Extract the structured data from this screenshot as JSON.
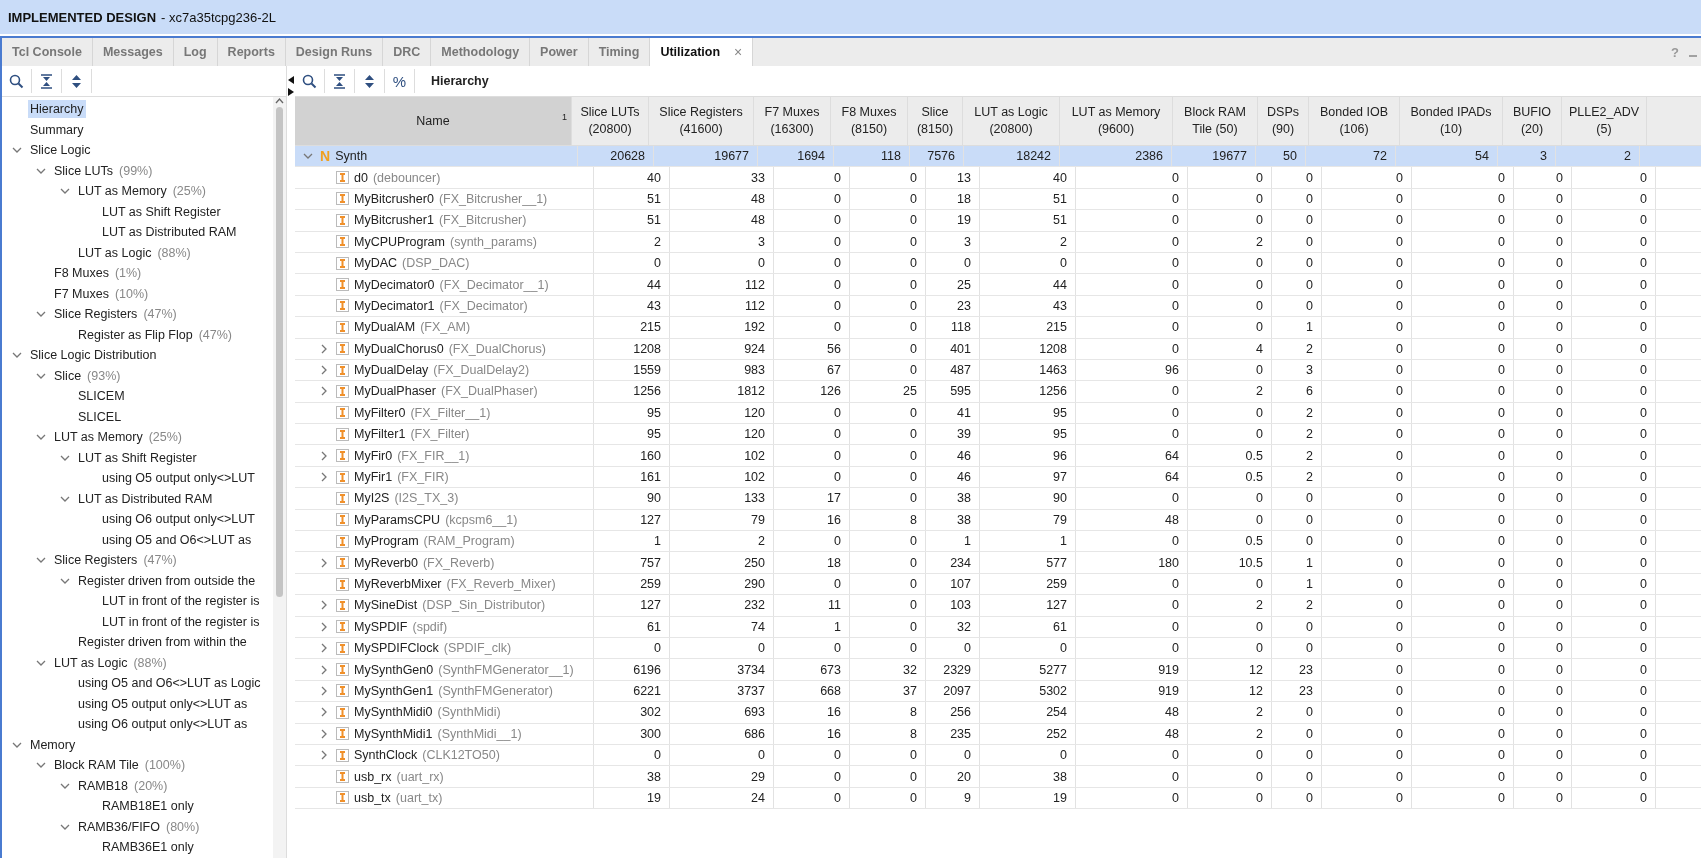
{
  "window": {
    "title": "IMPLEMENTED DESIGN",
    "subtitle": "- xc7a35tcpg236-2L"
  },
  "tabs": [
    {
      "label": "Tcl Console",
      "selected": false
    },
    {
      "label": "Messages",
      "selected": false
    },
    {
      "label": "Log",
      "selected": false
    },
    {
      "label": "Reports",
      "selected": false
    },
    {
      "label": "Design Runs",
      "selected": false
    },
    {
      "label": "DRC",
      "selected": false
    },
    {
      "label": "Methodology",
      "selected": false
    },
    {
      "label": "Power",
      "selected": false
    },
    {
      "label": "Timing",
      "selected": false
    },
    {
      "label": "Utilization",
      "selected": true,
      "close": "×"
    }
  ],
  "help": "?",
  "right_toolbar": {
    "percent": "%",
    "view": "Hierarchy"
  },
  "tree": [
    {
      "label": "Hierarchy",
      "selected": true
    },
    {
      "label": "Summary",
      "selected": false
    },
    {
      "label": "Slice Logic",
      "selected": false,
      "expanded": true,
      "children": [
        {
          "label": "Slice LUTs",
          "percent": "(99%)",
          "selected": false,
          "expanded": true,
          "children": [
            {
              "label": "LUT as Memory",
              "percent": "(25%)",
              "selected": false,
              "expanded": true,
              "children": [
                {
                  "label": "LUT as Shift Register",
                  "selected": false
                },
                {
                  "label": "LUT as Distributed RAM",
                  "selected": false
                }
              ]
            },
            {
              "label": "LUT as Logic",
              "percent": "(88%)",
              "selected": false
            }
          ]
        },
        {
          "label": "F8 Muxes",
          "percent": "(1%)",
          "selected": false
        },
        {
          "label": "F7 Muxes",
          "percent": "(10%)",
          "selected": false
        },
        {
          "label": "Slice Registers",
          "percent": "(47%)",
          "selected": false,
          "expanded": true,
          "children": [
            {
              "label": "Register as Flip Flop",
              "percent": "(47%)",
              "selected": false
            }
          ]
        }
      ]
    },
    {
      "label": "Slice Logic Distribution",
      "selected": false,
      "expanded": true,
      "children": [
        {
          "label": "Slice",
          "percent": "(93%)",
          "selected": false,
          "expanded": true,
          "children": [
            {
              "label": "SLICEM",
              "selected": false
            },
            {
              "label": "SLICEL",
              "selected": false
            }
          ]
        },
        {
          "label": "LUT as Memory",
          "percent": "(25%)",
          "selected": false,
          "expanded": true,
          "children": [
            {
              "label": "LUT as Shift Register",
              "selected": false,
              "expanded": true,
              "children": [
                {
                  "label": "using O5 output only<>LUT",
                  "selected": false
                }
              ]
            },
            {
              "label": "LUT as Distributed RAM",
              "selected": false,
              "expanded": true,
              "children": [
                {
                  "label": "using O6 output only<>LUT",
                  "selected": false
                },
                {
                  "label": "using O5 and O6<>LUT as",
                  "selected": false
                }
              ]
            }
          ]
        },
        {
          "label": "Slice Registers",
          "percent": "(47%)",
          "selected": false,
          "expanded": true,
          "children": [
            {
              "label": "Register driven from outside the",
              "selected": false,
              "expanded": true,
              "children": [
                {
                  "label": "LUT in front of the register is",
                  "selected": false
                },
                {
                  "label": "LUT in front of the register is",
                  "selected": false
                }
              ]
            },
            {
              "label": "Register driven from within the",
              "selected": false
            }
          ]
        },
        {
          "label": "LUT as Logic",
          "percent": "(88%)",
          "selected": false,
          "expanded": true,
          "children": [
            {
              "label": "using O5 and O6<>LUT as Logic",
              "selected": false
            },
            {
              "label": "using O5 output only<>LUT as",
              "selected": false
            },
            {
              "label": "using O6 output only<>LUT as",
              "selected": false
            }
          ]
        }
      ]
    },
    {
      "label": "Memory",
      "selected": false,
      "expanded": true,
      "children": [
        {
          "label": "Block RAM Tile",
          "percent": "(100%)",
          "selected": false,
          "expanded": true,
          "children": [
            {
              "label": "RAMB18",
              "percent": "(20%)",
              "selected": false,
              "expanded": true,
              "children": [
                {
                  "label": "RAMB18E1 only",
                  "selected": false
                }
              ]
            },
            {
              "label": "RAMB36/FIFO",
              "percent": "(80%)",
              "selected": false,
              "expanded": true,
              "children": [
                {
                  "label": "RAMB36E1 only",
                  "selected": false
                }
              ]
            }
          ]
        }
      ]
    }
  ],
  "table": {
    "columns": [
      {
        "label": "Name",
        "sort_rank": "1"
      },
      {
        "label": "Slice LUTs",
        "sub": "(20800)"
      },
      {
        "label": "Slice Registers",
        "sub": "(41600)"
      },
      {
        "label": "F7 Muxes",
        "sub": "(16300)"
      },
      {
        "label": "F8 Muxes",
        "sub": "(8150)"
      },
      {
        "label": "Slice",
        "sub": "(8150)"
      },
      {
        "label": "LUT as Logic",
        "sub": "(20800)"
      },
      {
        "label": "LUT as Memory",
        "sub": "(9600)"
      },
      {
        "label": "Block RAM",
        "sub": "Tile (50)"
      },
      {
        "label": "DSPs",
        "sub": "(90)"
      },
      {
        "label": "Bonded IOB",
        "sub": "(106)"
      },
      {
        "label": "Bonded IPADs",
        "sub": "(10)"
      },
      {
        "label": "BUFIO",
        "sub": "(20)"
      },
      {
        "label": "PLLE2_ADV",
        "sub": "(5)"
      }
    ],
    "rows": [
      {
        "kind": "top",
        "badge": "N",
        "name": "Synth",
        "selected": true,
        "expanded": true,
        "values": [
          "20628",
          "19677",
          "1694",
          "118",
          "7576",
          "18242",
          "2386",
          "19677",
          "50",
          "72",
          "54",
          "3",
          "2"
        ]
      },
      {
        "kind": "instance",
        "name": "d0",
        "module": "(debouncer)",
        "selected": false,
        "expandable": false,
        "values": [
          "40",
          "33",
          "0",
          "0",
          "13",
          "40",
          "0",
          "0",
          "0",
          "0",
          "0",
          "0",
          "0"
        ]
      },
      {
        "kind": "instance",
        "name": "MyBitcrusher0",
        "module": "(FX_Bitcrusher__1)",
        "selected": false,
        "expandable": false,
        "values": [
          "51",
          "48",
          "0",
          "0",
          "18",
          "51",
          "0",
          "0",
          "0",
          "0",
          "0",
          "0",
          "0"
        ]
      },
      {
        "kind": "instance",
        "name": "MyBitcrusher1",
        "module": "(FX_Bitcrusher)",
        "selected": false,
        "expandable": false,
        "values": [
          "51",
          "48",
          "0",
          "0",
          "19",
          "51",
          "0",
          "0",
          "0",
          "0",
          "0",
          "0",
          "0"
        ]
      },
      {
        "kind": "instance",
        "name": "MyCPUProgram",
        "module": "(synth_params)",
        "selected": false,
        "expandable": false,
        "values": [
          "2",
          "3",
          "0",
          "0",
          "3",
          "2",
          "0",
          "2",
          "0",
          "0",
          "0",
          "0",
          "0"
        ]
      },
      {
        "kind": "instance",
        "name": "MyDAC",
        "module": "(DSP_DAC)",
        "selected": false,
        "expandable": false,
        "values": [
          "0",
          "0",
          "0",
          "0",
          "0",
          "0",
          "0",
          "0",
          "0",
          "0",
          "0",
          "0",
          "0"
        ]
      },
      {
        "kind": "instance",
        "name": "MyDecimator0",
        "module": "(FX_Decimator__1)",
        "selected": false,
        "expandable": false,
        "values": [
          "44",
          "112",
          "0",
          "0",
          "25",
          "44",
          "0",
          "0",
          "0",
          "0",
          "0",
          "0",
          "0"
        ]
      },
      {
        "kind": "instance",
        "name": "MyDecimator1",
        "module": "(FX_Decimator)",
        "selected": false,
        "expandable": false,
        "values": [
          "43",
          "112",
          "0",
          "0",
          "23",
          "43",
          "0",
          "0",
          "0",
          "0",
          "0",
          "0",
          "0"
        ]
      },
      {
        "kind": "instance",
        "name": "MyDualAM",
        "module": "(FX_AM)",
        "selected": false,
        "expandable": false,
        "values": [
          "215",
          "192",
          "0",
          "0",
          "118",
          "215",
          "0",
          "0",
          "1",
          "0",
          "0",
          "0",
          "0"
        ]
      },
      {
        "kind": "instance",
        "name": "MyDualChorus0",
        "module": "(FX_DualChorus)",
        "selected": false,
        "expandable": true,
        "values": [
          "1208",
          "924",
          "56",
          "0",
          "401",
          "1208",
          "0",
          "4",
          "2",
          "0",
          "0",
          "0",
          "0"
        ]
      },
      {
        "kind": "instance",
        "name": "MyDualDelay",
        "module": "(FX_DualDelay2)",
        "selected": false,
        "expandable": true,
        "values": [
          "1559",
          "983",
          "67",
          "0",
          "487",
          "1463",
          "96",
          "0",
          "3",
          "0",
          "0",
          "0",
          "0"
        ]
      },
      {
        "kind": "instance",
        "name": "MyDualPhaser",
        "module": "(FX_DualPhaser)",
        "selected": false,
        "expandable": true,
        "values": [
          "1256",
          "1812",
          "126",
          "25",
          "595",
          "1256",
          "0",
          "2",
          "6",
          "0",
          "0",
          "0",
          "0"
        ]
      },
      {
        "kind": "instance",
        "name": "MyFilter0",
        "module": "(FX_Filter__1)",
        "selected": false,
        "expandable": false,
        "values": [
          "95",
          "120",
          "0",
          "0",
          "41",
          "95",
          "0",
          "0",
          "2",
          "0",
          "0",
          "0",
          "0"
        ]
      },
      {
        "kind": "instance",
        "name": "MyFilter1",
        "module": "(FX_Filter)",
        "selected": false,
        "expandable": false,
        "values": [
          "95",
          "120",
          "0",
          "0",
          "39",
          "95",
          "0",
          "0",
          "2",
          "0",
          "0",
          "0",
          "0"
        ]
      },
      {
        "kind": "instance",
        "name": "MyFir0",
        "module": "(FX_FIR__1)",
        "selected": false,
        "expandable": true,
        "values": [
          "160",
          "102",
          "0",
          "0",
          "46",
          "96",
          "64",
          "0.5",
          "2",
          "0",
          "0",
          "0",
          "0"
        ]
      },
      {
        "kind": "instance",
        "name": "MyFir1",
        "module": "(FX_FIR)",
        "selected": false,
        "expandable": true,
        "values": [
          "161",
          "102",
          "0",
          "0",
          "46",
          "97",
          "64",
          "0.5",
          "2",
          "0",
          "0",
          "0",
          "0"
        ]
      },
      {
        "kind": "instance",
        "name": "MyI2S",
        "module": "(I2S_TX_3)",
        "selected": false,
        "expandable": false,
        "values": [
          "90",
          "133",
          "17",
          "0",
          "38",
          "90",
          "0",
          "0",
          "0",
          "0",
          "0",
          "0",
          "0"
        ]
      },
      {
        "kind": "instance",
        "name": "MyParamsCPU",
        "module": "(kcpsm6__1)",
        "selected": false,
        "expandable": false,
        "values": [
          "127",
          "79",
          "16",
          "8",
          "38",
          "79",
          "48",
          "0",
          "0",
          "0",
          "0",
          "0",
          "0"
        ]
      },
      {
        "kind": "instance",
        "name": "MyProgram",
        "module": "(RAM_Program)",
        "selected": false,
        "expandable": false,
        "values": [
          "1",
          "2",
          "0",
          "0",
          "1",
          "1",
          "0",
          "0.5",
          "0",
          "0",
          "0",
          "0",
          "0"
        ]
      },
      {
        "kind": "instance",
        "name": "MyReverb0",
        "module": "(FX_Reverb)",
        "selected": false,
        "expandable": true,
        "values": [
          "757",
          "250",
          "18",
          "0",
          "234",
          "577",
          "180",
          "10.5",
          "1",
          "0",
          "0",
          "0",
          "0"
        ]
      },
      {
        "kind": "instance",
        "name": "MyReverbMixer",
        "module": "(FX_Reverb_Mixer)",
        "selected": false,
        "expandable": false,
        "values": [
          "259",
          "290",
          "0",
          "0",
          "107",
          "259",
          "0",
          "0",
          "1",
          "0",
          "0",
          "0",
          "0"
        ]
      },
      {
        "kind": "instance",
        "name": "MySineDist",
        "module": "(DSP_Sin_Distributor)",
        "selected": false,
        "expandable": true,
        "values": [
          "127",
          "232",
          "11",
          "0",
          "103",
          "127",
          "0",
          "2",
          "2",
          "0",
          "0",
          "0",
          "0"
        ]
      },
      {
        "kind": "instance",
        "name": "MySPDIF",
        "module": "(spdif)",
        "selected": false,
        "expandable": true,
        "values": [
          "61",
          "74",
          "1",
          "0",
          "32",
          "61",
          "0",
          "0",
          "0",
          "0",
          "0",
          "0",
          "0"
        ]
      },
      {
        "kind": "instance",
        "name": "MySPDIFClock",
        "module": "(SPDIF_clk)",
        "selected": false,
        "expandable": true,
        "values": [
          "0",
          "0",
          "0",
          "0",
          "0",
          "0",
          "0",
          "0",
          "0",
          "0",
          "0",
          "0",
          "0"
        ]
      },
      {
        "kind": "instance",
        "name": "MySynthGen0",
        "module": "(SynthFMGenerator__1)",
        "selected": false,
        "expandable": true,
        "values": [
          "6196",
          "3734",
          "673",
          "32",
          "2329",
          "5277",
          "919",
          "12",
          "23",
          "0",
          "0",
          "0",
          "0"
        ]
      },
      {
        "kind": "instance",
        "name": "MySynthGen1",
        "module": "(SynthFMGenerator)",
        "selected": false,
        "expandable": true,
        "values": [
          "6221",
          "3737",
          "668",
          "37",
          "2097",
          "5302",
          "919",
          "12",
          "23",
          "0",
          "0",
          "0",
          "0"
        ]
      },
      {
        "kind": "instance",
        "name": "MySynthMidi0",
        "module": "(SynthMidi)",
        "selected": false,
        "expandable": true,
        "values": [
          "302",
          "693",
          "16",
          "8",
          "256",
          "254",
          "48",
          "2",
          "0",
          "0",
          "0",
          "0",
          "0"
        ]
      },
      {
        "kind": "instance",
        "name": "MySynthMidi1",
        "module": "(SynthMidi__1)",
        "selected": false,
        "expandable": true,
        "values": [
          "300",
          "686",
          "16",
          "8",
          "235",
          "252",
          "48",
          "2",
          "0",
          "0",
          "0",
          "0",
          "0"
        ]
      },
      {
        "kind": "instance",
        "name": "SynthClock",
        "module": "(CLK12TO50)",
        "selected": false,
        "expandable": true,
        "values": [
          "0",
          "0",
          "0",
          "0",
          "0",
          "0",
          "0",
          "0",
          "0",
          "0",
          "0",
          "0",
          "0"
        ]
      },
      {
        "kind": "instance",
        "name": "usb_rx",
        "module": "(uart_rx)",
        "selected": false,
        "expandable": false,
        "values": [
          "38",
          "29",
          "0",
          "0",
          "20",
          "38",
          "0",
          "0",
          "0",
          "0",
          "0",
          "0",
          "0"
        ]
      },
      {
        "kind": "instance",
        "name": "usb_tx",
        "module": "(uart_tx)",
        "selected": false,
        "expandable": false,
        "values": [
          "19",
          "24",
          "0",
          "0",
          "9",
          "19",
          "0",
          "0",
          "0",
          "0",
          "0",
          "0",
          "0"
        ]
      }
    ]
  }
}
